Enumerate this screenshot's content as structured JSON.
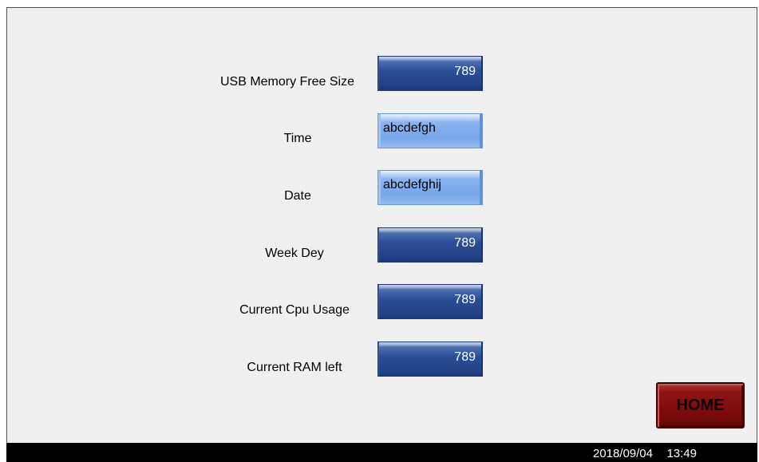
{
  "rows": [
    {
      "label": "USB Memory Free Size",
      "value": "789",
      "style": "dark"
    },
    {
      "label": "Time",
      "value": "abcdefgh",
      "style": "light"
    },
    {
      "label": "Date",
      "value": "abcdefghij",
      "style": "light"
    },
    {
      "label": "Week Dey",
      "value": "789",
      "style": "dark"
    },
    {
      "label": "Current Cpu Usage",
      "value": "789",
      "style": "dark"
    },
    {
      "label": "Current RAM left",
      "value": "789",
      "style": "dark"
    }
  ],
  "home_button": {
    "label": "HOME"
  },
  "status_bar": {
    "date": "2018/09/04",
    "time": "13:49"
  },
  "colors": {
    "field_dark": "#2b4f96",
    "field_light": "#8bb4ef",
    "home_button": "#7a0a0a",
    "background": "#f0f0f0",
    "status_bar": "#000000"
  }
}
